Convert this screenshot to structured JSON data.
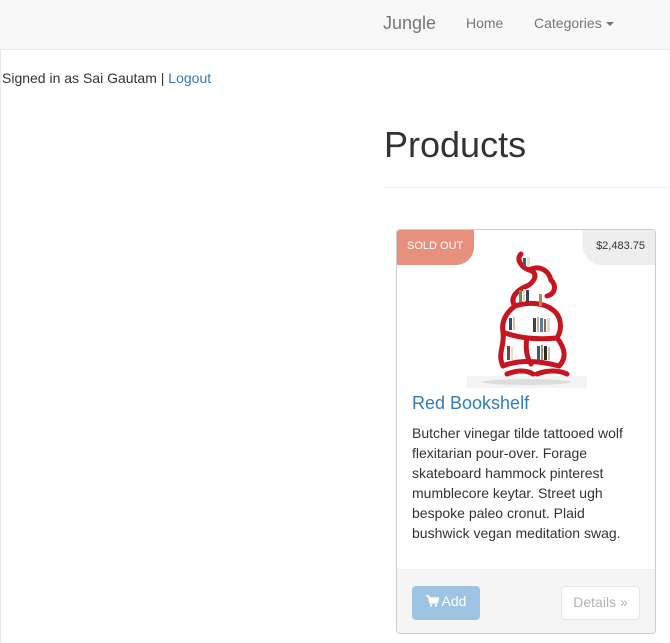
{
  "navbar": {
    "brand": "Jungle",
    "home_label": "Home",
    "categories_label": "Categories"
  },
  "session": {
    "signed_in_text": "Signed in as Sai Gautam | ",
    "logout_label": "Logout"
  },
  "page": {
    "title": "Products"
  },
  "product": {
    "badge": "SOLD OUT",
    "price": "$2,483.75",
    "name": "Red Bookshelf",
    "description": "Butcher vinegar tilde tattooed wolf flexitarian pour-over. Forage skateboard hammock pinterest mumblecore keytar. Street ugh bespoke paleo cronut. Plaid bushwick vegan meditation swag.",
    "add_label": "Add",
    "details_label": "Details »",
    "image_icon": "red-bookshelf-image"
  },
  "icons": {
    "cart": "shopping-cart-icon",
    "caret": "caret-down-icon"
  },
  "colors": {
    "link": "#337ab7",
    "sold_badge": "#e8907e",
    "add_button": "#9fc3e2",
    "shelf_red": "#c8141e"
  }
}
